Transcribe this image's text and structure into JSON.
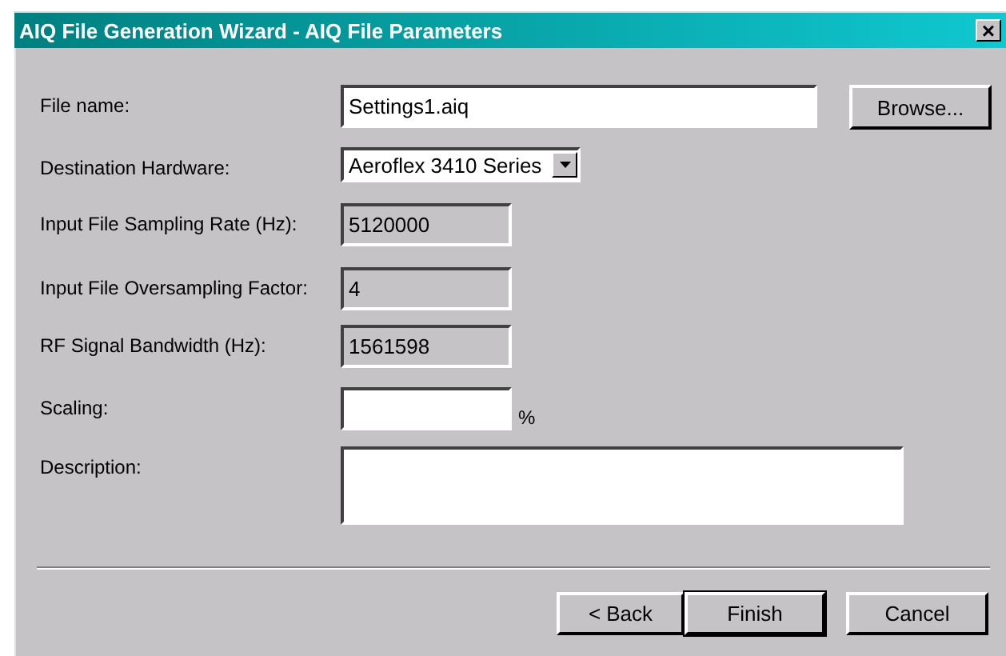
{
  "window": {
    "title": "AIQ File Generation Wizard - AIQ File Parameters",
    "close": "×"
  },
  "fields": [
    {
      "label": "File name:",
      "kind": "text",
      "value": "Settings1.aiq",
      "button": "Browse..."
    },
    {
      "label": "Destination Hardware:",
      "kind": "dropdown",
      "value": "Aeroflex 3410 Series"
    },
    {
      "label": "Input File Sampling Rate (Hz):",
      "kind": "readonly",
      "value": "5120000"
    },
    {
      "label": "Input File Oversampling Factor:",
      "kind": "readonly",
      "value": "4"
    },
    {
      "label": "RF Signal Bandwidth (Hz):",
      "kind": "readonly",
      "value": "1561598"
    },
    {
      "label": "Scaling:",
      "kind": "text",
      "suffix": "%"
    },
    {
      "label": "Description:",
      "kind": "multiline"
    }
  ],
  "buttons": [
    {
      "label": "< Back",
      "default": false
    },
    {
      "label": "Finish",
      "default": true
    },
    {
      "label": "Cancel",
      "default": false
    }
  ]
}
